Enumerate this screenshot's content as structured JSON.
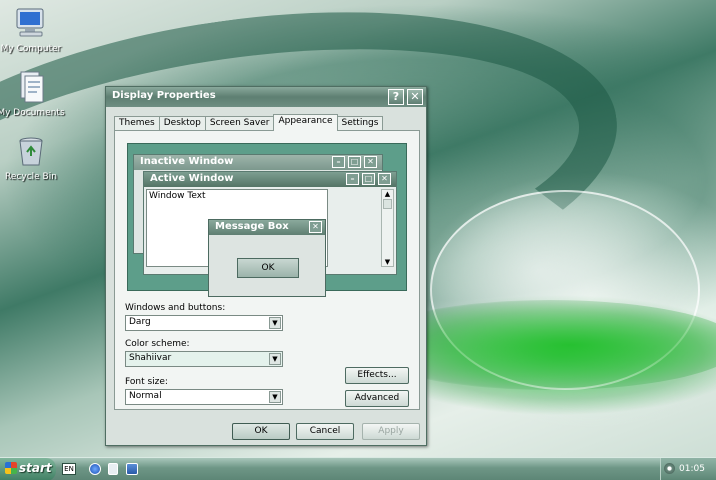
{
  "desktop": {
    "icons": [
      {
        "label": "My Computer"
      },
      {
        "label": "My Documents"
      },
      {
        "label": "Recycle Bin"
      }
    ]
  },
  "dialog": {
    "title": "Display Properties",
    "help_label": "?",
    "close_label": "✕",
    "tabs": [
      {
        "label": "Themes"
      },
      {
        "label": "Desktop"
      },
      {
        "label": "Screen Saver"
      },
      {
        "label": "Appearance",
        "active": true
      },
      {
        "label": "Settings"
      }
    ],
    "preview": {
      "inactive_title": "Inactive Window",
      "active_title": "Active Window",
      "window_text": "Window Text",
      "message_title": "Message Box",
      "ok_label": "OK"
    },
    "windows_buttons": {
      "label": "Windows and buttons:",
      "value": "Darg"
    },
    "color_scheme": {
      "label": "Color scheme:",
      "value": "Shahiivar"
    },
    "font_size": {
      "label": "Font size:",
      "value": "Normal"
    },
    "effects_label": "Effects...",
    "advanced_label": "Advanced",
    "ok_label": "OK",
    "cancel_label": "Cancel",
    "apply_label": "Apply"
  },
  "taskbar": {
    "start_label": "start",
    "language": "EN",
    "clock": "01:05"
  },
  "colors": {
    "accent": "#5e7f72",
    "preview_bg": "#5d9e8a"
  }
}
